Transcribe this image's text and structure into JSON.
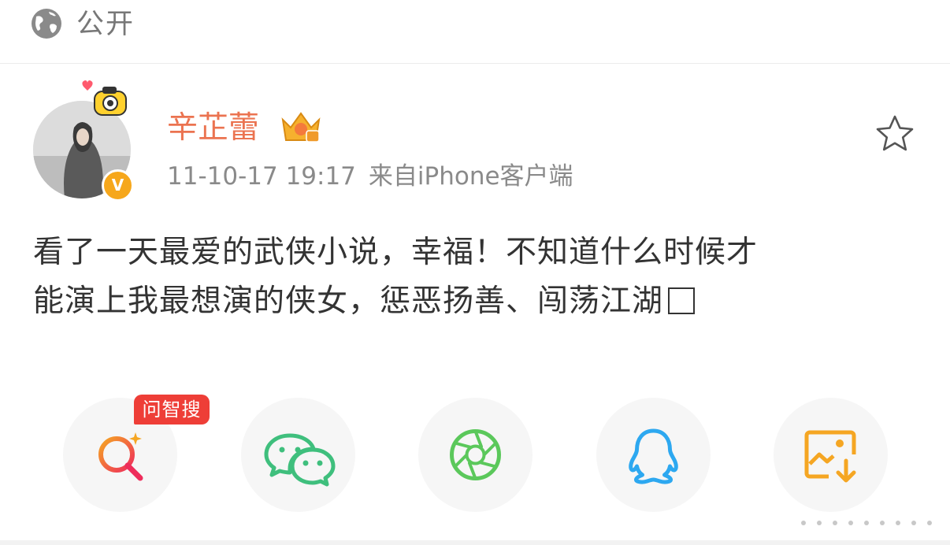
{
  "header": {
    "visibility_icon": "globe-icon",
    "visibility_label": "公开"
  },
  "post": {
    "author": {
      "name": "辛芷蕾",
      "avatar": "avatar",
      "verified_badge": "V",
      "member_badge": "crown-icon"
    },
    "timestamp": "11-10-17 19:17",
    "source": "来自iPhone客户端",
    "favorite_icon": "star-outline-icon",
    "text_lines": [
      "看了一天最爱的武侠小说，幸福！不知道什么时候才",
      "能演上我最想演的侠女，惩恶扬善、闯荡江湖"
    ],
    "trailing_glyph": "□"
  },
  "share_bar": {
    "tag": "问智搜",
    "buttons": [
      {
        "name": "search-ai-icon",
        "color": "#f0445a"
      },
      {
        "name": "wechat-icon",
        "color": "#3fbf7d"
      },
      {
        "name": "moments-icon",
        "color": "#5bc85b"
      },
      {
        "name": "qq-icon",
        "color": "#2da8f0"
      },
      {
        "name": "save-image-icon",
        "color": "#f5a623"
      }
    ]
  },
  "colors": {
    "accent": "#eb7350",
    "meta_text": "#8a8a8a",
    "body_text": "#333333",
    "tag_red": "#ee3e37",
    "badge_orange": "#f6a71b"
  }
}
